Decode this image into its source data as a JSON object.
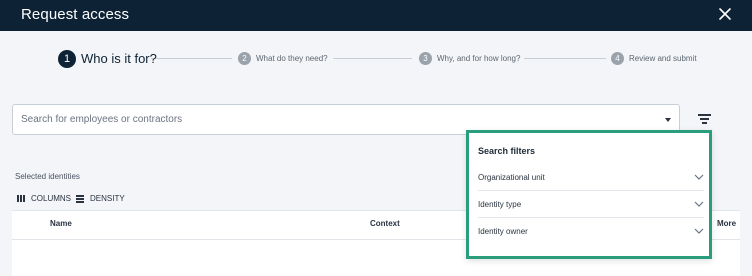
{
  "header": {
    "title": "Request access",
    "close_icon": "close-icon"
  },
  "stepper": {
    "steps": [
      {
        "number": "1",
        "label": "Who is it for?",
        "state": "active"
      },
      {
        "number": "2",
        "label": "What do they need?",
        "state": "inactive"
      },
      {
        "number": "3",
        "label": "Why, and for how long?",
        "state": "inactive"
      },
      {
        "number": "4",
        "label": "Review and submit",
        "state": "inactive"
      }
    ]
  },
  "search": {
    "placeholder": "Search for employees or contractors",
    "dropdown_icon": "caret-down-icon"
  },
  "filter_button": {
    "icon": "filter-icon"
  },
  "identities": {
    "section_label": "Selected identities",
    "toolbar": {
      "columns_label": "COLUMNS",
      "density_label": "DENSITY"
    },
    "columns": [
      "Name",
      "Context",
      "More"
    ]
  },
  "filters_panel": {
    "title": "Search filters",
    "items": [
      "Organizational unit",
      "Identity type",
      "Identity owner"
    ],
    "highlight_color": "#2a9d7c"
  },
  "colors": {
    "header_bg": "#0d2235",
    "page_bg": "#f3f5f8"
  }
}
